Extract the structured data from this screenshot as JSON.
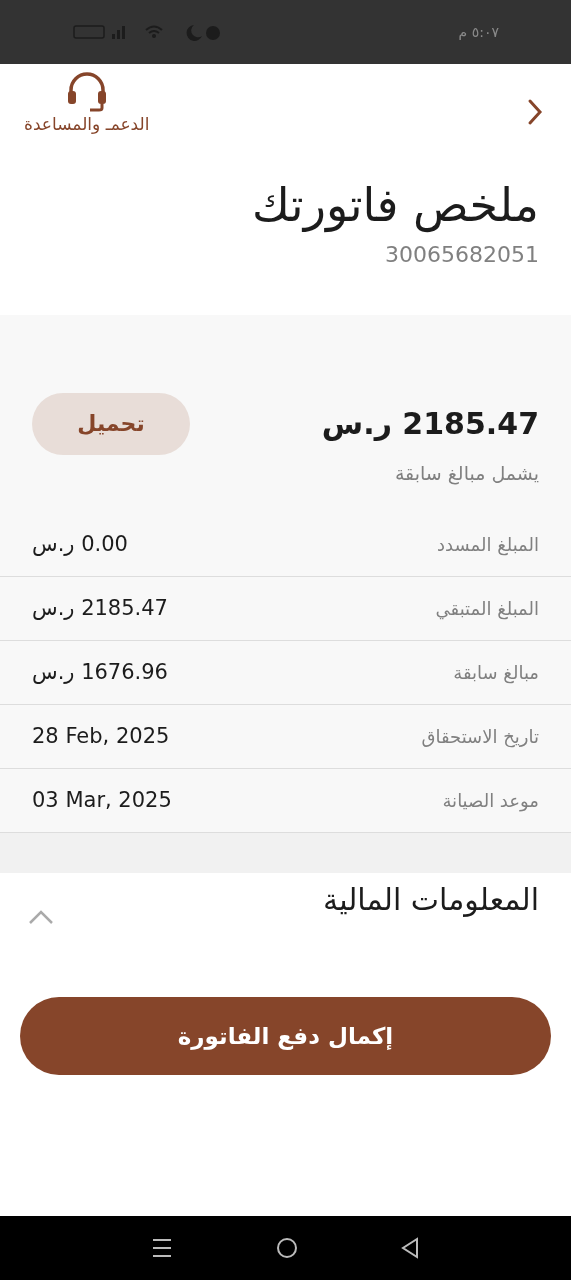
{
  "status_bar": {
    "time": "٥:٠٧ م"
  },
  "header": {
    "support_label": "الدعمـ والمساعدة"
  },
  "title": "ملخص فاتورتك",
  "account_number": "30065682051",
  "summary": {
    "total": "2185.47 ر.س",
    "download_button": "تحميل",
    "note": "يشمل مبالغ سابقة",
    "rows": [
      {
        "label": "المبلغ المسدد",
        "value": "0.00 ر.س"
      },
      {
        "label": "المبلغ المتبقي",
        "value": "2185.47 ر.س"
      },
      {
        "label": "مبالغ سابقة",
        "value": "1676.96 ر.س"
      },
      {
        "label": "تاريخ الاستحقاق",
        "value": "28 Feb, 2025"
      },
      {
        "label": "موعد الصيانة",
        "value": "03 Mar, 2025"
      }
    ]
  },
  "financial_section": {
    "title": "المعلومات المالية",
    "expanded": true
  },
  "pay_button": "إكمال دفع الفاتورة"
}
